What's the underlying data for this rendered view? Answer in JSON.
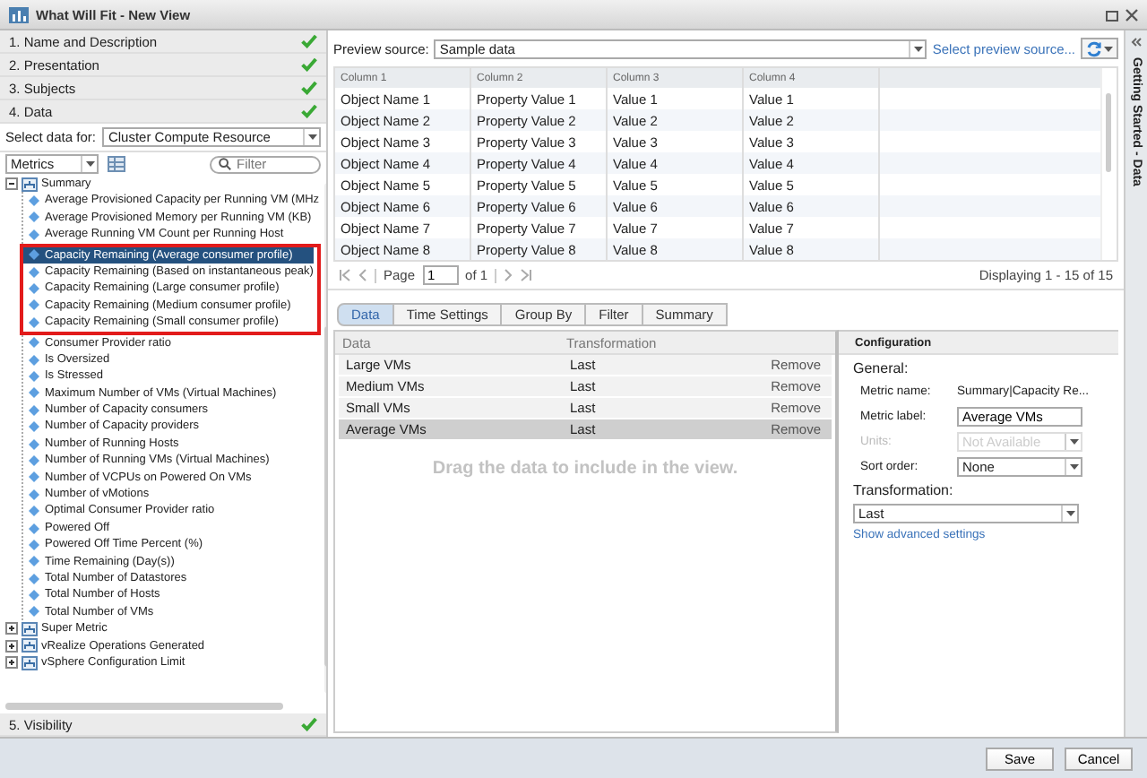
{
  "window": {
    "title": "What Will Fit - New View"
  },
  "steps": [
    {
      "label": "1. Name and Description",
      "complete": true
    },
    {
      "label": "2. Presentation",
      "complete": true
    },
    {
      "label": "3. Subjects",
      "complete": true
    },
    {
      "label": "4. Data",
      "complete": true
    }
  ],
  "select_data": {
    "label": "Select data for:",
    "value": "Cluster Compute Resource"
  },
  "metrics_dropdown": {
    "value": "Metrics"
  },
  "filter": {
    "placeholder": "Filter"
  },
  "tree": [
    {
      "label": "Summary",
      "expanded": true,
      "children": [
        {
          "label": "Average Provisioned Capacity per Running VM (MHz",
          "selected": false,
          "highlighted": false
        },
        {
          "label": "Average Provisioned Memory per Running VM (KB)",
          "selected": false,
          "highlighted": false
        },
        {
          "label": "Average Running VM Count per Running Host",
          "selected": false,
          "highlighted": false
        },
        {
          "label": "Capacity Remaining (Average consumer profile)",
          "selected": true,
          "highlighted": true
        },
        {
          "label": "Capacity Remaining (Based on instantaneous peak)",
          "selected": false,
          "highlighted": true
        },
        {
          "label": "Capacity Remaining (Large consumer profile)",
          "selected": false,
          "highlighted": true
        },
        {
          "label": "Capacity Remaining (Medium consumer profile)",
          "selected": false,
          "highlighted": true
        },
        {
          "label": "Capacity Remaining (Small consumer profile)",
          "selected": false,
          "highlighted": true
        },
        {
          "label": "Consumer Provider ratio",
          "selected": false,
          "highlighted": false
        },
        {
          "label": "Is Oversized",
          "selected": false,
          "highlighted": false
        },
        {
          "label": "Is Stressed",
          "selected": false,
          "highlighted": false
        },
        {
          "label": "Maximum Number of VMs (Virtual Machines)",
          "selected": false,
          "highlighted": false
        },
        {
          "label": "Number of Capacity consumers",
          "selected": false,
          "highlighted": false
        },
        {
          "label": "Number of Capacity providers",
          "selected": false,
          "highlighted": false
        },
        {
          "label": "Number of Running Hosts",
          "selected": false,
          "highlighted": false
        },
        {
          "label": "Number of Running VMs (Virtual Machines)",
          "selected": false,
          "highlighted": false
        },
        {
          "label": "Number of VCPUs on Powered On VMs",
          "selected": false,
          "highlighted": false
        },
        {
          "label": "Number of vMotions",
          "selected": false,
          "highlighted": false
        },
        {
          "label": "Optimal Consumer Provider ratio",
          "selected": false,
          "highlighted": false
        },
        {
          "label": "Powered Off",
          "selected": false,
          "highlighted": false
        },
        {
          "label": "Powered Off Time Percent (%)",
          "selected": false,
          "highlighted": false
        },
        {
          "label": "Time Remaining (Day(s))",
          "selected": false,
          "highlighted": false
        },
        {
          "label": "Total Number of Datastores",
          "selected": false,
          "highlighted": false
        },
        {
          "label": "Total Number of Hosts",
          "selected": false,
          "highlighted": false
        },
        {
          "label": "Total Number of VMs",
          "selected": false,
          "highlighted": false
        }
      ]
    },
    {
      "label": "Super Metric",
      "expanded": false
    },
    {
      "label": "vRealize Operations Generated",
      "expanded": false
    },
    {
      "label": "vSphere Configuration Limit",
      "expanded": false
    }
  ],
  "visibility_step": {
    "label": "5. Visibility",
    "complete": true
  },
  "preview": {
    "source_label": "Preview source:",
    "source_value": "Sample data",
    "select_link": "Select preview source...",
    "columns": [
      "Column 1",
      "Column 2",
      "Column 3",
      "Column 4"
    ],
    "rows": [
      [
        "Object Name 1",
        "Property Value 1",
        "Value 1",
        "Value 1"
      ],
      [
        "Object Name 2",
        "Property Value 2",
        "Value 2",
        "Value 2"
      ],
      [
        "Object Name 3",
        "Property Value 3",
        "Value 3",
        "Value 3"
      ],
      [
        "Object Name 4",
        "Property Value 4",
        "Value 4",
        "Value 4"
      ],
      [
        "Object Name 5",
        "Property Value 5",
        "Value 5",
        "Value 5"
      ],
      [
        "Object Name 6",
        "Property Value 6",
        "Value 6",
        "Value 6"
      ],
      [
        "Object Name 7",
        "Property Value 7",
        "Value 7",
        "Value 7"
      ],
      [
        "Object Name 8",
        "Property Value 8",
        "Value 8",
        "Value 8"
      ]
    ],
    "page_label": "Page",
    "page_value": "1",
    "page_of": "of 1",
    "displaying": "Displaying 1 - 15 of 15"
  },
  "tabs": [
    {
      "label": "Data",
      "selected": true
    },
    {
      "label": "Time Settings",
      "selected": false
    },
    {
      "label": "Group By",
      "selected": false
    },
    {
      "label": "Filter",
      "selected": false
    },
    {
      "label": "Summary",
      "selected": false
    }
  ],
  "data_table": {
    "columns": [
      "Data",
      "Transformation"
    ],
    "rows": [
      {
        "data": "Large VMs",
        "transformation": "Last",
        "action": "Remove",
        "selected": false
      },
      {
        "data": "Medium VMs",
        "transformation": "Last",
        "action": "Remove",
        "selected": false
      },
      {
        "data": "Small VMs",
        "transformation": "Last",
        "action": "Remove",
        "selected": false
      },
      {
        "data": "Average VMs",
        "transformation": "Last",
        "action": "Remove",
        "selected": true
      }
    ],
    "hint": "Drag the data to include in the view."
  },
  "configuration": {
    "title": "Configuration",
    "section": "General:",
    "fields": [
      {
        "kind": "text",
        "label": "Metric name:",
        "value": "Summary|Capacity Re...",
        "disabled": false
      },
      {
        "kind": "input",
        "label": "Metric label:",
        "value": "Average VMs",
        "disabled": false
      },
      {
        "kind": "select",
        "label": "Units:",
        "value": "Not Available",
        "disabled": true
      },
      {
        "kind": "select",
        "label": "Sort order:",
        "value": "None",
        "disabled": false
      }
    ],
    "transformation_label": "Transformation:",
    "transformation_value": "Last",
    "advanced_link": "Show advanced settings"
  },
  "side_panel": {
    "title": "Getting Started - Data"
  },
  "buttons": [
    "Save",
    "Cancel"
  ]
}
